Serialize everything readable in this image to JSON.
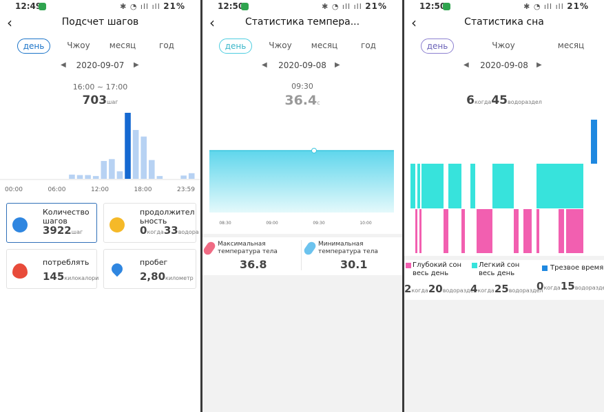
{
  "steps": {
    "status": {
      "time": "12:49",
      "battery": "21%"
    },
    "title": "Подсчет шагов",
    "tabs": [
      "день",
      "Чжоу",
      "месяц",
      "год"
    ],
    "date": "2020-09-07",
    "range": "16:00 ~ 17:00",
    "value": "703",
    "unit": "шаг",
    "x_labels": [
      "00:00",
      "06:00",
      "12:00",
      "18:00",
      "23:59"
    ],
    "cards": [
      {
        "label": "Количество шагов",
        "value": "3922",
        "unit": "шаг"
      },
      {
        "label": "продолжительность",
        "value_a": "0",
        "unit_a": "когда",
        "value_b": "33",
        "unit_b": "водора"
      },
      {
        "label": "потреблять",
        "value": "145",
        "unit": "килокалори"
      },
      {
        "label": "пробег",
        "value": "2,80",
        "unit": "километр"
      }
    ]
  },
  "temp": {
    "status": {
      "time": "12:50",
      "battery": "21%"
    },
    "title": "Статистика темпера...",
    "tabs": [
      "день",
      "Чжоу",
      "месяц",
      "год"
    ],
    "date": "2020-09-08",
    "time": "09:30",
    "value": "36.4",
    "unit": "c",
    "x_labels": [
      "08:30",
      "09:00",
      "09:30",
      "10:00"
    ],
    "max_label": "Максимальная температура тела",
    "max_value": "36.8",
    "min_label": "Минимальная температура тела",
    "min_value": "30.1"
  },
  "sleep": {
    "status": {
      "time": "12:50",
      "battery": "21%"
    },
    "title": "Статистика сна",
    "tabs": [
      "день",
      "Чжоу",
      "месяц"
    ],
    "date": "2020-09-08",
    "total_a": "6",
    "unit_a": "когда",
    "total_b": "45",
    "unit_b": "водораздел",
    "legend": [
      {
        "label": "Глубокий сон весь день",
        "color": "#f25fb0",
        "h": "2",
        "hu": "когда",
        "m": "20",
        "mu": "водораздел"
      },
      {
        "label": "Легкий сон весь день",
        "color": "#37e3dc",
        "h": "4",
        "hu": "когда",
        "m": "25",
        "mu": "водораздел"
      },
      {
        "label": "Трезвое время",
        "color": "#1e88e0",
        "h": "0",
        "hu": "когда",
        "m": "15",
        "mu": "водораздел"
      }
    ]
  },
  "chart_data": [
    {
      "type": "bar",
      "title": "Подсчет шагов",
      "categories": [
        "0",
        "1",
        "2",
        "3",
        "4",
        "5",
        "6",
        "7",
        "8",
        "9",
        "10",
        "11",
        "12",
        "13",
        "14",
        "15",
        "16",
        "17",
        "18",
        "19",
        "20",
        "21",
        "22",
        "23"
      ],
      "values": [
        0,
        0,
        0,
        0,
        0,
        0,
        0,
        0,
        45,
        40,
        40,
        30,
        190,
        210,
        80,
        703,
        520,
        450,
        200,
        30,
        0,
        0,
        35,
        60
      ],
      "highlight_index": 15,
      "colors": {
        "normal": "#b7d2f3",
        "highlight": "#1569d1"
      }
    },
    {
      "type": "area",
      "title": "Статистика температуры",
      "x": [
        "08:30",
        "09:00",
        "09:30",
        "10:00"
      ],
      "values": [
        36.4,
        36.4,
        36.4,
        36.4
      ],
      "colors": {
        "top": "#5fd6ec",
        "bottom": "#e4f9fb"
      }
    }
  ]
}
